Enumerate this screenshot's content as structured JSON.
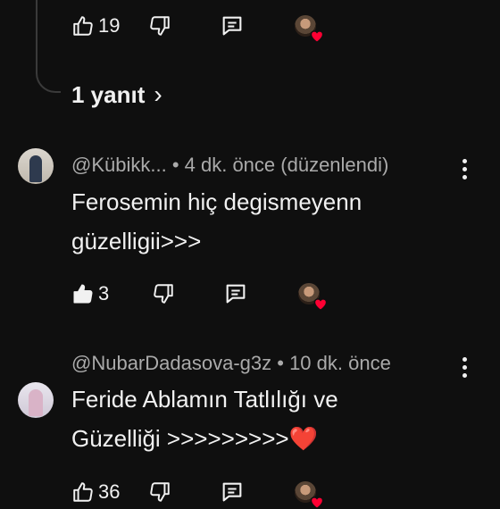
{
  "top_comment": {
    "like_count": "19"
  },
  "replies_link": {
    "label": "1 yanıt",
    "chevron": "›"
  },
  "comments": [
    {
      "handle": "@Kübikk...",
      "meta": "• 4 dk. önce (düzenlendi)",
      "text_line1": "Ferosemin hiç degismeyenn",
      "text_line2": "güzelligii>>>",
      "like_count": "3",
      "liked": true
    },
    {
      "handle": "@NubarDadasova-g3z",
      "meta": "• 10 dk. önce",
      "text_line1": "Feride Ablamın Tatlılığı ve",
      "text_line2": "Güzelliği >>>>>>>>>",
      "text_emoji": "❤️",
      "like_count": "36",
      "liked": false
    }
  ],
  "icons": {
    "like": "thumbs-up-icon",
    "dislike": "thumbs-down-icon",
    "reply": "comment-reply-icon",
    "creator_heart": "creator-heart-icon",
    "more": "more-vert-icon"
  },
  "colors": {
    "background": "#0f0f0f",
    "text": "#f1f1f1",
    "meta": "#aaaaaa",
    "heart": "#ff0033"
  }
}
